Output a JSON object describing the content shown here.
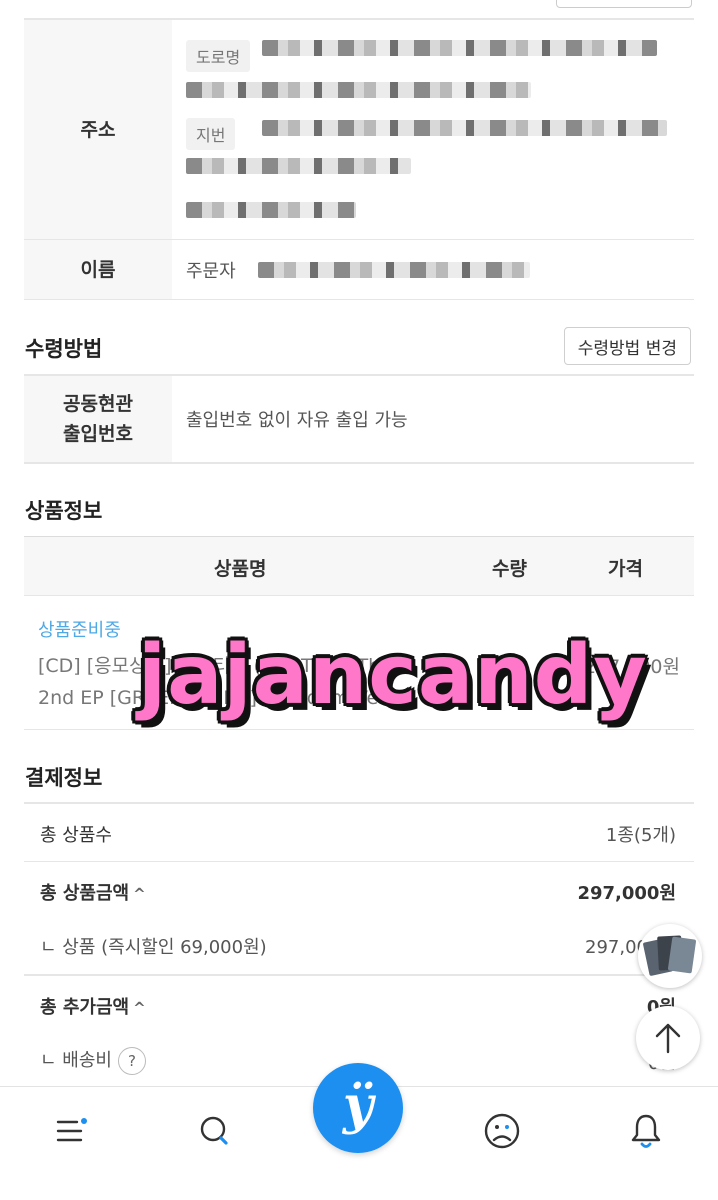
{
  "address_section": {
    "address_label": "주소",
    "road_tag": "도로명",
    "lot_tag": "지번",
    "name_label": "이름",
    "name_prefix": "주문자"
  },
  "receive_method": {
    "title": "수령방법",
    "change_button": "수령방법 변경",
    "entrance_label_line1": "공동현관",
    "entrance_label_line2": "출입번호",
    "entrance_value": "출입번호 없이 자유 출입 가능"
  },
  "product_info": {
    "title": "상품정보",
    "columns": {
      "name": "상품명",
      "qty": "수량",
      "price": "가격"
    },
    "item": {
      "status": "상품준비중",
      "name_line1": "[CD] [응모상품] 코르티스 (CORTIS) - The",
      "name_line2": "2nd EP [GREENGREEN] (Random Ver.)",
      "qty": "5",
      "price": "297,000원"
    }
  },
  "watermark": "jajancandy",
  "payment_info": {
    "title": "결제정보",
    "rows": [
      {
        "label": "총 상품수",
        "value": "1종(5개)"
      },
      {
        "label": "총 상품금액",
        "caret": "^",
        "value": "297,000원"
      },
      {
        "label": "ㄴ 상품 (즉시할인 69,000원)",
        "value": "297,000원"
      },
      {
        "label": "총 추가금액",
        "caret": "^",
        "value": "0원"
      },
      {
        "label": "ㄴ 배송비",
        "help": "?",
        "value": "0원"
      }
    ]
  },
  "colors": {
    "accent": "#1c8ff0",
    "status": "#4ea9e6",
    "watermark": "#ff77c8"
  },
  "bottom_nav": {
    "items": [
      "menu-icon",
      "search-icon",
      "home-logo",
      "profile-icon",
      "bell-icon"
    ],
    "logo_glyph": "ÿ"
  }
}
